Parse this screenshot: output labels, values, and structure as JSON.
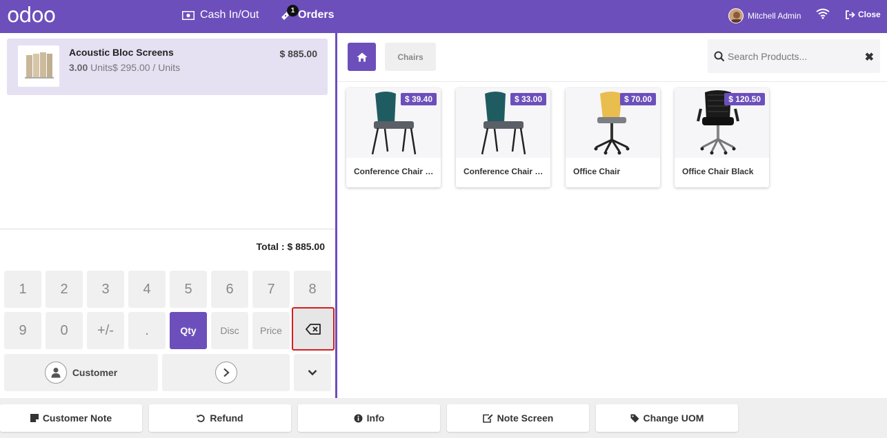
{
  "header": {
    "logo": "odoo",
    "cash_label": "Cash In/Out",
    "orders_label": "Orders",
    "orders_count": "1",
    "user_name": "Mitchell Admin",
    "close_label": "Close"
  },
  "order": {
    "line": {
      "name": "Acoustic Bloc Screens",
      "qty": "3.00",
      "unit_detail": "Units$ 295.00 / Units",
      "price": "$ 885.00"
    },
    "total_label": "Total :",
    "total_value": "$ 885.00"
  },
  "numpad": {
    "keys": [
      "1",
      "2",
      "3",
      "4",
      "5",
      "6",
      "7",
      "8",
      "9",
      "0",
      "+/-",
      "."
    ],
    "qty": "Qty",
    "disc": "Disc",
    "price": "Price",
    "customer": "Customer"
  },
  "products_panel": {
    "category": "Chairs",
    "search_placeholder": "Search Products...",
    "items": [
      {
        "name": "Conference Chair (Steel)",
        "price": "$ 39.40"
      },
      {
        "name": "Conference Chair (Aluminium)",
        "price": "$ 33.00"
      },
      {
        "name": "Office Chair",
        "price": "$ 70.00"
      },
      {
        "name": "Office Chair Black",
        "price": "$ 120.50"
      }
    ]
  },
  "control_buttons": [
    "Customer Note",
    "Refund",
    "Info",
    "Note Screen",
    "Change UOM"
  ],
  "colors": {
    "accent": "#6c4fbb",
    "highlight_border": "#d21e1e"
  }
}
